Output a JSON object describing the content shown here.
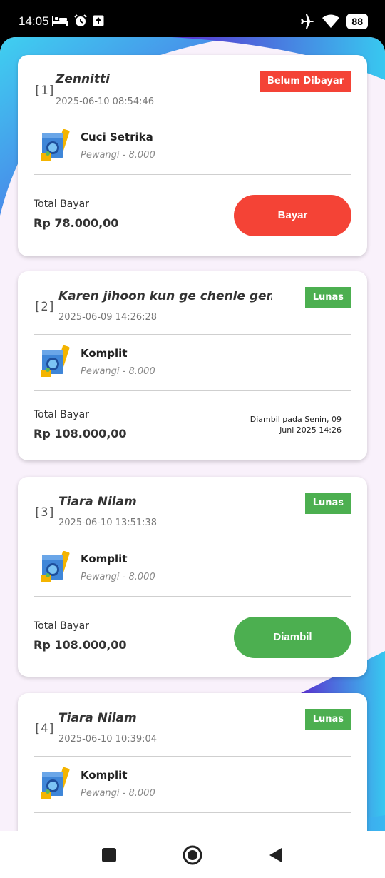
{
  "status_bar": {
    "time": "14:05",
    "left_icons": [
      "bed-icon",
      "alarm-icon",
      "upload-icon"
    ],
    "right_icons": [
      "airplane-icon",
      "wifi-icon"
    ],
    "battery": "88"
  },
  "colors": {
    "red": "#f44336",
    "green": "#4caf50",
    "background": "#f9f1fb"
  },
  "orders": [
    {
      "index": "[1]",
      "name": "Zennitti",
      "date": "2025-06-10 08:54:46",
      "status": "Belum Dibayar",
      "status_color": "red",
      "service": "Cuci Setrika",
      "detail": "Pewangi - 8.000",
      "total_label": "Total Bayar",
      "total": "Rp 78.000,00",
      "action": "Bayar"
    },
    {
      "index": "[2]",
      "name": "Karen jihoon kun ge chenle gemes",
      "date": "2025-06-09 14:26:28",
      "status": "Lunas",
      "status_color": "green",
      "service": "Komplit",
      "detail": "Pewangi - 8.000",
      "total_label": "Total Bayar",
      "total": "Rp 108.000,00",
      "pickup_line1": "Diambil pada Senin, 09",
      "pickup_line2": "Juni 2025 14:26"
    },
    {
      "index": "[3]",
      "name": "Tiara Nilam",
      "date": "2025-06-10 13:51:38",
      "status": "Lunas",
      "status_color": "green",
      "service": "Komplit",
      "detail": "Pewangi - 8.000",
      "total_label": "Total Bayar",
      "total": "Rp 108.000,00",
      "action": "Diambil"
    },
    {
      "index": "[4]",
      "name": "Tiara Nilam",
      "date": "2025-06-10 10:39:04",
      "status": "Lunas",
      "status_color": "green",
      "service": "Komplit",
      "detail": "Pewangi - 8.000"
    }
  ],
  "nav": [
    "recents-square-icon",
    "home-circle-icon",
    "back-triangle-icon"
  ]
}
